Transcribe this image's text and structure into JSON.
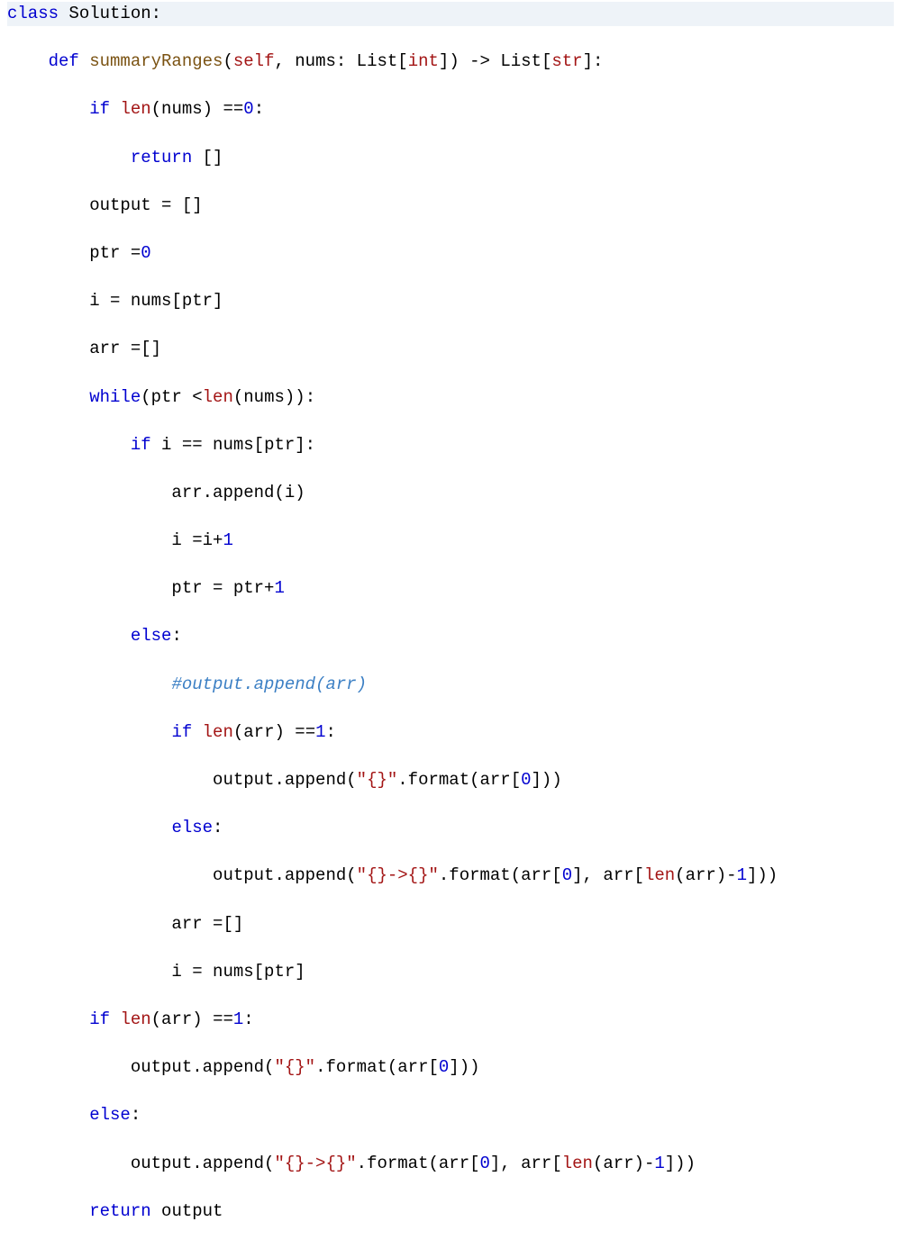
{
  "code": {
    "lines": [
      [
        {
          "t": "class ",
          "c": "kw"
        },
        {
          "t": "Solution:",
          "c": "plain"
        }
      ],
      [
        {
          "t": "    ",
          "c": "plain"
        },
        {
          "t": "def ",
          "c": "kw"
        },
        {
          "t": "summaryRanges",
          "c": "fn"
        },
        {
          "t": "(",
          "c": "plain"
        },
        {
          "t": "self",
          "c": "self"
        },
        {
          "t": ", nums: List[",
          "c": "plain"
        },
        {
          "t": "int",
          "c": "builtin"
        },
        {
          "t": "]) -> List[",
          "c": "plain"
        },
        {
          "t": "str",
          "c": "builtin"
        },
        {
          "t": "]:",
          "c": "plain"
        }
      ],
      [
        {
          "t": "        ",
          "c": "plain"
        },
        {
          "t": "if ",
          "c": "kw"
        },
        {
          "t": "len",
          "c": "builtin"
        },
        {
          "t": "(nums) ==",
          "c": "plain"
        },
        {
          "t": "0",
          "c": "num"
        },
        {
          "t": ":",
          "c": "plain"
        }
      ],
      [
        {
          "t": "            ",
          "c": "plain"
        },
        {
          "t": "return ",
          "c": "kw"
        },
        {
          "t": "[]",
          "c": "plain"
        }
      ],
      [
        {
          "t": "        output = []",
          "c": "plain"
        }
      ],
      [
        {
          "t": "        ptr =",
          "c": "plain"
        },
        {
          "t": "0",
          "c": "num"
        }
      ],
      [
        {
          "t": "        i = nums[ptr]",
          "c": "plain"
        }
      ],
      [
        {
          "t": "        arr =[]",
          "c": "plain"
        }
      ],
      [
        {
          "t": "        ",
          "c": "plain"
        },
        {
          "t": "while",
          "c": "kw"
        },
        {
          "t": "(ptr <",
          "c": "plain"
        },
        {
          "t": "len",
          "c": "builtin"
        },
        {
          "t": "(nums)):",
          "c": "plain"
        }
      ],
      [
        {
          "t": "            ",
          "c": "plain"
        },
        {
          "t": "if ",
          "c": "kw"
        },
        {
          "t": "i == nums[ptr]:",
          "c": "plain"
        }
      ],
      [
        {
          "t": "                arr.append(i)",
          "c": "plain"
        }
      ],
      [
        {
          "t": "                i =i+",
          "c": "plain"
        },
        {
          "t": "1",
          "c": "num"
        }
      ],
      [
        {
          "t": "                ptr = ptr+",
          "c": "plain"
        },
        {
          "t": "1",
          "c": "num"
        }
      ],
      [
        {
          "t": "            ",
          "c": "plain"
        },
        {
          "t": "else",
          "c": "kw"
        },
        {
          "t": ":",
          "c": "plain"
        }
      ],
      [
        {
          "t": "                ",
          "c": "plain"
        },
        {
          "t": "#output.append(arr)",
          "c": "cmt"
        }
      ],
      [
        {
          "t": "                ",
          "c": "plain"
        },
        {
          "t": "if ",
          "c": "kw"
        },
        {
          "t": "len",
          "c": "builtin"
        },
        {
          "t": "(arr) ==",
          "c": "plain"
        },
        {
          "t": "1",
          "c": "num"
        },
        {
          "t": ":",
          "c": "plain"
        }
      ],
      [
        {
          "t": "                    output.append(",
          "c": "plain"
        },
        {
          "t": "\"{}\"",
          "c": "str"
        },
        {
          "t": ".format(arr[",
          "c": "plain"
        },
        {
          "t": "0",
          "c": "num"
        },
        {
          "t": "]))",
          "c": "plain"
        }
      ],
      [
        {
          "t": "                ",
          "c": "plain"
        },
        {
          "t": "else",
          "c": "kw"
        },
        {
          "t": ":",
          "c": "plain"
        }
      ],
      [
        {
          "t": "                    output.append(",
          "c": "plain"
        },
        {
          "t": "\"{}->{}\"",
          "c": "str"
        },
        {
          "t": ".format(arr[",
          "c": "plain"
        },
        {
          "t": "0",
          "c": "num"
        },
        {
          "t": "], arr[",
          "c": "plain"
        },
        {
          "t": "len",
          "c": "builtin"
        },
        {
          "t": "(arr)-",
          "c": "plain"
        },
        {
          "t": "1",
          "c": "num"
        },
        {
          "t": "]))",
          "c": "plain"
        }
      ],
      [
        {
          "t": "                arr =[]",
          "c": "plain"
        }
      ],
      [
        {
          "t": "                i = nums[ptr]",
          "c": "plain"
        }
      ],
      [
        {
          "t": "        ",
          "c": "plain"
        },
        {
          "t": "if ",
          "c": "kw"
        },
        {
          "t": "len",
          "c": "builtin"
        },
        {
          "t": "(arr) ==",
          "c": "plain"
        },
        {
          "t": "1",
          "c": "num"
        },
        {
          "t": ":",
          "c": "plain"
        }
      ],
      [
        {
          "t": "            output.append(",
          "c": "plain"
        },
        {
          "t": "\"{}\"",
          "c": "str"
        },
        {
          "t": ".format(arr[",
          "c": "plain"
        },
        {
          "t": "0",
          "c": "num"
        },
        {
          "t": "]))",
          "c": "plain"
        }
      ],
      [
        {
          "t": "        ",
          "c": "plain"
        },
        {
          "t": "else",
          "c": "kw"
        },
        {
          "t": ":",
          "c": "plain"
        }
      ],
      [
        {
          "t": "            output.append(",
          "c": "plain"
        },
        {
          "t": "\"{}->{}\"",
          "c": "str"
        },
        {
          "t": ".format(arr[",
          "c": "plain"
        },
        {
          "t": "0",
          "c": "num"
        },
        {
          "t": "], arr[",
          "c": "plain"
        },
        {
          "t": "len",
          "c": "builtin"
        },
        {
          "t": "(arr)-",
          "c": "plain"
        },
        {
          "t": "1",
          "c": "num"
        },
        {
          "t": "]))",
          "c": "plain"
        }
      ],
      [
        {
          "t": "        ",
          "c": "plain"
        },
        {
          "t": "return ",
          "c": "kw"
        },
        {
          "t": "output",
          "c": "plain"
        }
      ]
    ],
    "highlight_line_index": 0
  }
}
